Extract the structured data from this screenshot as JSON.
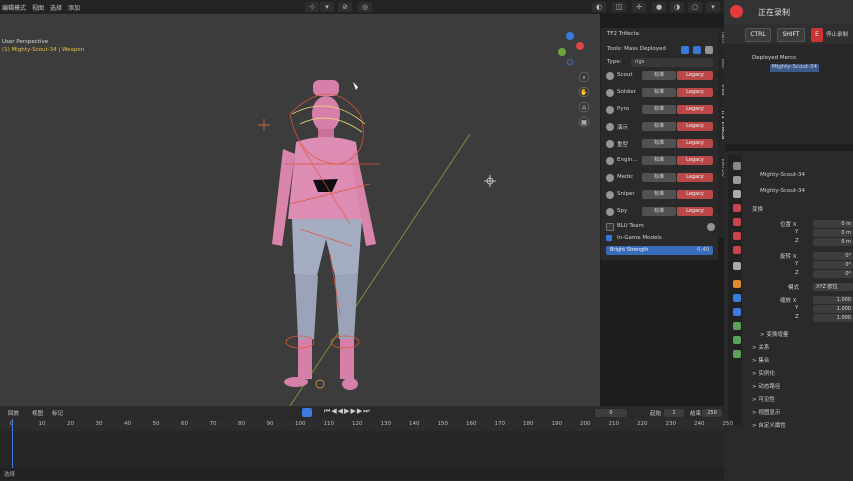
{
  "header": {
    "left_menus": [
      "编辑模式",
      "视图",
      "选择",
      "添加"
    ],
    "viewport_mode": "User Perspective",
    "object_info": "(1) Mighty-Scout-34 | Weapon"
  },
  "npanel": {
    "title": "TF2 Trifecta",
    "section": "Tools: Mass Deployed",
    "type_label": "Type:",
    "type_value": "rigs",
    "classes": [
      {
        "name": "Scout",
        "a": "标准",
        "b": "Legacy"
      },
      {
        "name": "Soldier",
        "a": "标准",
        "b": "Legacy"
      },
      {
        "name": "Pyro",
        "a": "标准",
        "b": "Legacy"
      },
      {
        "name": "演示",
        "a": "标准",
        "b": "Legacy"
      },
      {
        "name": "重型",
        "a": "标准",
        "b": "Legacy"
      },
      {
        "name": "Engin...",
        "a": "标准",
        "b": "Legacy"
      },
      {
        "name": "Medic",
        "a": "标准",
        "b": "Legacy"
      },
      {
        "name": "Sniper",
        "a": "标准",
        "b": "Legacy"
      },
      {
        "name": "Spy",
        "a": "标准",
        "b": "Legacy"
      }
    ],
    "check1": "BLU Team",
    "check2": "In-Game Models",
    "highlight": "Bright Strength",
    "highlight_value": "0.40",
    "vertical_tabs": [
      "Item",
      "Tool",
      "View",
      "TF2 Trifecta",
      "VIRTUO"
    ]
  },
  "recording": {
    "text": "正在录制",
    "keys": [
      "CTRL",
      "SHIFT",
      "E"
    ],
    "key_hint": "停止录制"
  },
  "outliner": {
    "items": [
      "Deployed Mercs",
      "Mighty-Scout-34"
    ]
  },
  "properties": {
    "object_name": "Mighty-Scout-34",
    "data_name": "Mighty-Scout-34",
    "section": "变换",
    "fields": [
      {
        "label": "位置 X",
        "value": "0 m"
      },
      {
        "label": "Y",
        "value": "0 m"
      },
      {
        "label": "Z",
        "value": "0 m"
      },
      {
        "label": "旋转 X",
        "value": "0°"
      },
      {
        "label": "Y",
        "value": "0°"
      },
      {
        "label": "Z",
        "value": "0°"
      },
      {
        "label": "模式",
        "value": "XYZ 欧拉"
      },
      {
        "label": "缩放 X",
        "value": "1.000"
      },
      {
        "label": "Y",
        "value": "1.000"
      },
      {
        "label": "Z",
        "value": "1.000"
      }
    ],
    "collapsed": [
      "> 变换增量",
      "> 关系",
      "> 集合",
      "> 实例化",
      "> 动态路径",
      "> 可见性",
      "> 视图显示",
      "> 自定义属性"
    ]
  },
  "timeline": {
    "menus": [
      "回放",
      "视图",
      "标记"
    ],
    "current_frame": "0",
    "start_label": "起始",
    "start": "1",
    "end_label": "结束",
    "end": "250",
    "ticks": [
      "0",
      "10",
      "20",
      "30",
      "40",
      "50",
      "60",
      "70",
      "80",
      "90",
      "100",
      "110",
      "120",
      "130",
      "140",
      "150",
      "160",
      "170",
      "180",
      "190",
      "200",
      "210",
      "220",
      "230",
      "240",
      "250"
    ]
  },
  "status": "选择"
}
